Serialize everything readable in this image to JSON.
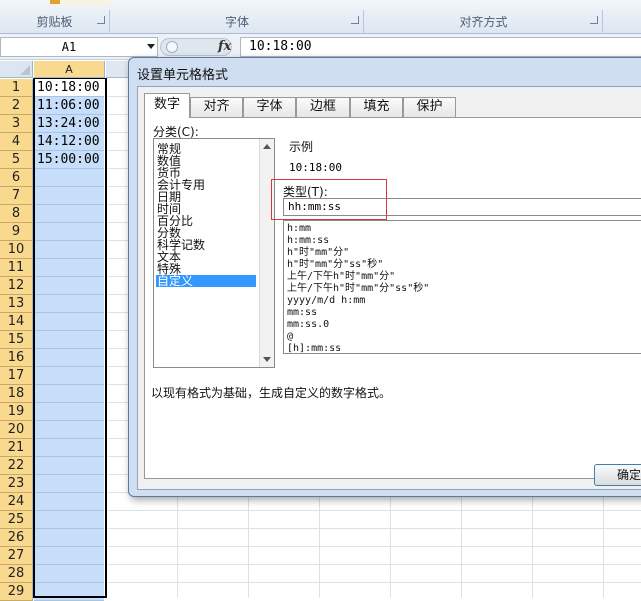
{
  "ribbon": {
    "groups": [
      {
        "label": "剪贴板"
      },
      {
        "label": "字体"
      },
      {
        "label": "对齐方式"
      }
    ]
  },
  "formula_bar": {
    "name_box": "A1",
    "fx_label": "fx",
    "formula": "10:18:00"
  },
  "grid": {
    "column_a": "A",
    "rows": [
      {
        "num": "1",
        "value": "10:18:00"
      },
      {
        "num": "2",
        "value": "11:06:00"
      },
      {
        "num": "3",
        "value": "13:24:00"
      },
      {
        "num": "4",
        "value": "14:12:00"
      },
      {
        "num": "5",
        "value": "15:00:00"
      },
      {
        "num": "6",
        "value": ""
      },
      {
        "num": "7",
        "value": ""
      },
      {
        "num": "8",
        "value": ""
      },
      {
        "num": "9",
        "value": ""
      },
      {
        "num": "10",
        "value": ""
      },
      {
        "num": "11",
        "value": ""
      },
      {
        "num": "12",
        "value": ""
      },
      {
        "num": "13",
        "value": ""
      },
      {
        "num": "14",
        "value": ""
      },
      {
        "num": "15",
        "value": ""
      },
      {
        "num": "16",
        "value": ""
      },
      {
        "num": "17",
        "value": ""
      },
      {
        "num": "18",
        "value": ""
      },
      {
        "num": "19",
        "value": ""
      },
      {
        "num": "20",
        "value": ""
      },
      {
        "num": "21",
        "value": ""
      },
      {
        "num": "22",
        "value": ""
      },
      {
        "num": "23",
        "value": ""
      },
      {
        "num": "24",
        "value": ""
      },
      {
        "num": "25",
        "value": ""
      },
      {
        "num": "26",
        "value": ""
      },
      {
        "num": "27",
        "value": ""
      },
      {
        "num": "28",
        "value": ""
      },
      {
        "num": "29",
        "value": ""
      }
    ]
  },
  "dialog": {
    "title": "设置单元格格式",
    "tabs": [
      {
        "label": "数字"
      },
      {
        "label": "对齐"
      },
      {
        "label": "字体"
      },
      {
        "label": "边框"
      },
      {
        "label": "填充"
      },
      {
        "label": "保护"
      }
    ],
    "category_label": "分类(C):",
    "categories": [
      {
        "label": "常规"
      },
      {
        "label": "数值"
      },
      {
        "label": "货币"
      },
      {
        "label": "会计专用"
      },
      {
        "label": "日期"
      },
      {
        "label": "时间"
      },
      {
        "label": "百分比"
      },
      {
        "label": "分数"
      },
      {
        "label": "科学记数"
      },
      {
        "label": "文本"
      },
      {
        "label": "特殊"
      },
      {
        "label": "自定义"
      }
    ],
    "sample_label": "示例",
    "sample_value": "10:18:00",
    "type_label": "类型(T):",
    "type_value": "hh:mm:ss",
    "formats": [
      {
        "label": "h:mm"
      },
      {
        "label": "h:mm:ss"
      },
      {
        "label": "h\"时\"mm\"分\""
      },
      {
        "label": "h\"时\"mm\"分\"ss\"秒\""
      },
      {
        "label": "上午/下午h\"时\"mm\"分\""
      },
      {
        "label": "上午/下午h\"时\"mm\"分\"ss\"秒\""
      },
      {
        "label": "yyyy/m/d h:mm"
      },
      {
        "label": "mm:ss"
      },
      {
        "label": "mm:ss.0"
      },
      {
        "label": "@"
      },
      {
        "label": "[h]:mm:ss"
      }
    ],
    "description": "以现有格式为基础，生成自定义的数字格式。",
    "ok_label": "确定"
  },
  "colors": {
    "selection_fill": "#c6defa",
    "header_highlight": "#f9d98e",
    "list_selected": "#3399ff",
    "annotation_red": "#d9363e"
  }
}
